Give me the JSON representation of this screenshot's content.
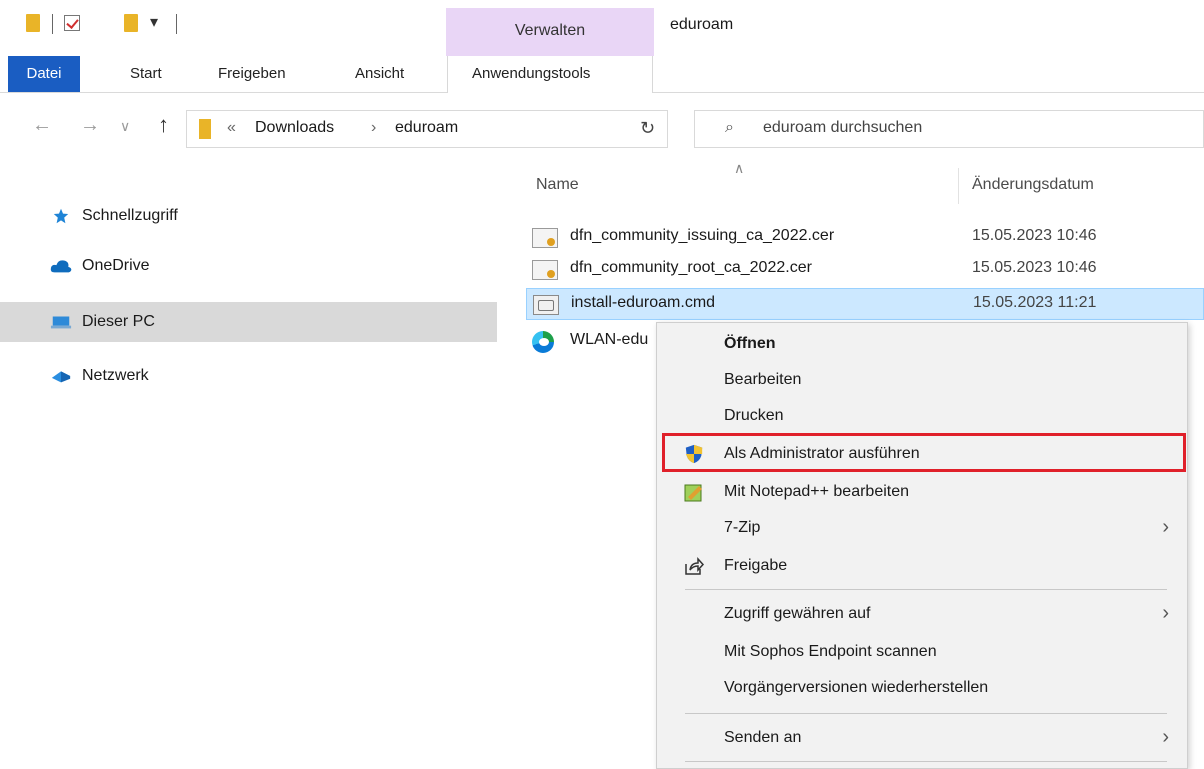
{
  "quick_access": {
    "items": [
      "folder-icon",
      "properties-check-icon",
      "new-folder-icon",
      "customize-dropdown-icon"
    ]
  },
  "ribbon": {
    "contextual_group_label": "Verwalten",
    "window_title": "eduroam",
    "tabs": [
      {
        "label": "Datei",
        "active": false
      },
      {
        "label": "Start",
        "active": false
      },
      {
        "label": "Freigeben",
        "active": false
      },
      {
        "label": "Ansicht",
        "active": false
      },
      {
        "label": "Anwendungstools",
        "active": true
      }
    ]
  },
  "address_bar": {
    "overflow_glyph": "«",
    "breadcrumb": [
      "Downloads",
      "eduroam"
    ],
    "separator": "›"
  },
  "search": {
    "placeholder": "eduroam durchsuchen"
  },
  "nav_pane": {
    "items": [
      {
        "label": "Schnellzugriff",
        "icon": "star-icon",
        "selected": false
      },
      {
        "label": "OneDrive",
        "icon": "cloud-icon",
        "selected": false
      },
      {
        "label": "Dieser PC",
        "icon": "computer-icon",
        "selected": true
      },
      {
        "label": "Netzwerk",
        "icon": "network-icon",
        "selected": false
      }
    ]
  },
  "file_list": {
    "columns": {
      "name": "Name",
      "date": "Änderungsdatum"
    },
    "files": [
      {
        "name": "dfn_community_issuing_ca_2022.cer",
        "date": "15.05.2023 10:46",
        "type": "certificate",
        "selected": false
      },
      {
        "name": "dfn_community_root_ca_2022.cer",
        "date": "15.05.2023 10:46",
        "type": "certificate",
        "selected": false
      },
      {
        "name": "install-eduroam.cmd",
        "date": "15.05.2023 11:21",
        "type": "cmd",
        "selected": true
      },
      {
        "name": "WLAN-edu",
        "date": "",
        "type": "edge",
        "selected": false
      }
    ]
  },
  "context_menu": {
    "items": [
      {
        "label": "Öffnen",
        "bold": true,
        "icon": null,
        "submenu": false
      },
      {
        "label": "Bearbeiten",
        "bold": false,
        "icon": null,
        "submenu": false
      },
      {
        "label": "Drucken",
        "bold": false,
        "icon": null,
        "submenu": false
      },
      {
        "label": "Als Administrator ausführen",
        "bold": false,
        "icon": "uac-shield-icon",
        "submenu": false,
        "highlighted": true
      },
      {
        "label": "Mit Notepad++ bearbeiten",
        "bold": false,
        "icon": "notepadpp-icon",
        "submenu": false
      },
      {
        "label": "7-Zip",
        "bold": false,
        "icon": null,
        "submenu": true
      },
      {
        "label": "Freigabe",
        "bold": false,
        "icon": "share-icon",
        "submenu": false
      },
      {
        "label": "Zugriff gewähren auf",
        "bold": false,
        "icon": null,
        "submenu": true
      },
      {
        "label": "Mit Sophos Endpoint scannen",
        "bold": false,
        "icon": null,
        "submenu": false
      },
      {
        "label": "Vorgängerversionen wiederherstellen",
        "bold": false,
        "icon": null,
        "submenu": false
      },
      {
        "label": "Senden an",
        "bold": false,
        "icon": null,
        "submenu": true
      }
    ],
    "submenu_glyph": "›",
    "highlight_color": "#e0202a"
  },
  "colors": {
    "datei_tab": "#1a5dc2",
    "contextual_group": "#e9d6f6",
    "selection": "#cce8ff",
    "nav_selected": "#d9d9d9"
  }
}
